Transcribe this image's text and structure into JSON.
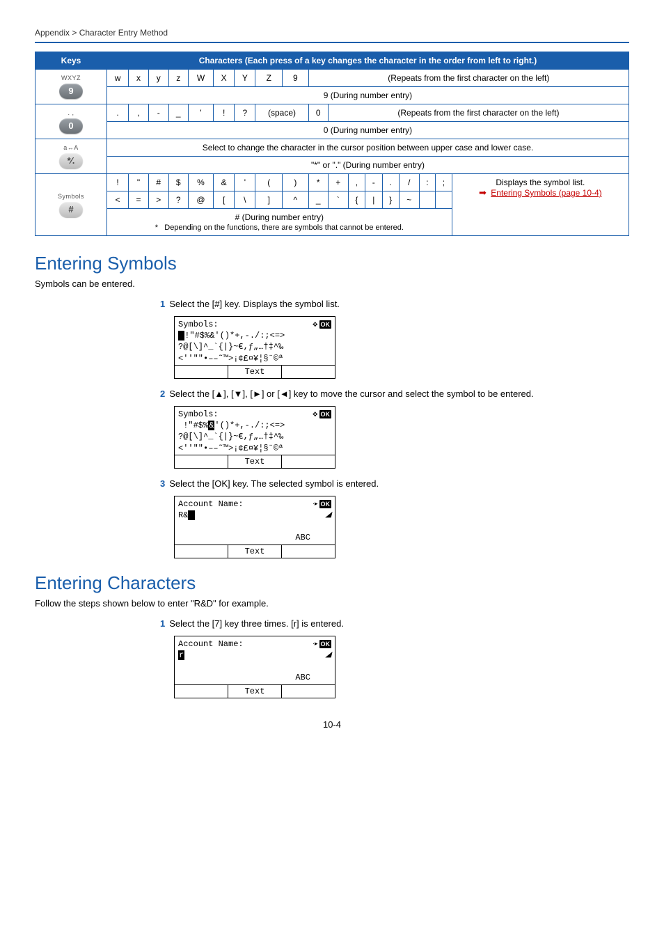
{
  "breadcrumb": "Appendix > Character Entry Method",
  "table": {
    "head_keys": "Keys",
    "head_chars": "Characters (Each press of a key changes the character in the order from left to right.)",
    "row9": {
      "label": "WXYZ",
      "chars": [
        "w",
        "x",
        "y",
        "z",
        "W",
        "X",
        "Y",
        "Z",
        "9"
      ],
      "repeat": "(Repeats from the first character on the left)",
      "note": "9 (During number entry)"
    },
    "row0": {
      "chars": [
        ".",
        ",",
        "-",
        "_",
        "'",
        "!",
        "?",
        "(space)",
        "0"
      ],
      "repeat": "(Repeats from the first character on the left)",
      "note": "0 (During number entry)"
    },
    "rowStar": {
      "note1": "Select to change the character in the cursor position between upper case and lower case.",
      "note2": "\"*\" or \".\" (During number entry)"
    },
    "rowHash": {
      "label": "Symbols",
      "r1": [
        "!",
        "\"",
        "#",
        "$",
        "%",
        "&",
        "'",
        "(",
        ")",
        "*",
        "+",
        ",",
        "-",
        ".",
        "/",
        ":",
        ";"
      ],
      "r2": [
        "<",
        "=",
        ">",
        "?",
        "@",
        "[",
        "\\",
        "]",
        "^",
        "_",
        "`",
        "{",
        "|",
        "}",
        "~",
        "",
        ""
      ],
      "side_text": "Displays the symbol list.",
      "link_text": "Entering Symbols (page 10-4)",
      "note": "# (During number entry)",
      "foot": "Depending on the functions, there are symbols that cannot be entered."
    }
  },
  "sec1": {
    "title": "Entering Symbols",
    "desc": "Symbols can be entered.",
    "step1": "Select the [#] key. Displays the symbol list.",
    "step2_a": "Select the [",
    "step2_b": "], [",
    "step2_c": "], [",
    "step2_d": "] or [",
    "step2_e": "] key to move the cursor and select the symbol to be entered.",
    "step3": "Select the [OK] key. The selected symbol is entered.",
    "lcd_title": "Symbols:",
    "lcd_l1a": "!\"#$%&'()*+,-./:;<=>",
    "lcd_l2": "?@[\\]^_`{|}~€,ƒ„…†‡^‰",
    "lcd_l3": "<''\"\"•––˜™>¡¢£¤¥¦§¨©ª",
    "lcd_tab": "Text",
    "lcd2_l1": " !\"#$%&'()*+,-./:;<=>",
    "acct_title": "Account Name:",
    "acct_val": "R&",
    "acct_mode": "ABC",
    "acct_tab": "Text"
  },
  "sec2": {
    "title": "Entering Characters",
    "desc": "Follow the steps shown below to enter \"R&D\" for example.",
    "step1": "Select the [7] key three times. [r] is entered.",
    "acct_title": "Account Name:",
    "acct_val": "r",
    "acct_mode": "ABC",
    "acct_tab": "Text"
  },
  "page": "10-4"
}
